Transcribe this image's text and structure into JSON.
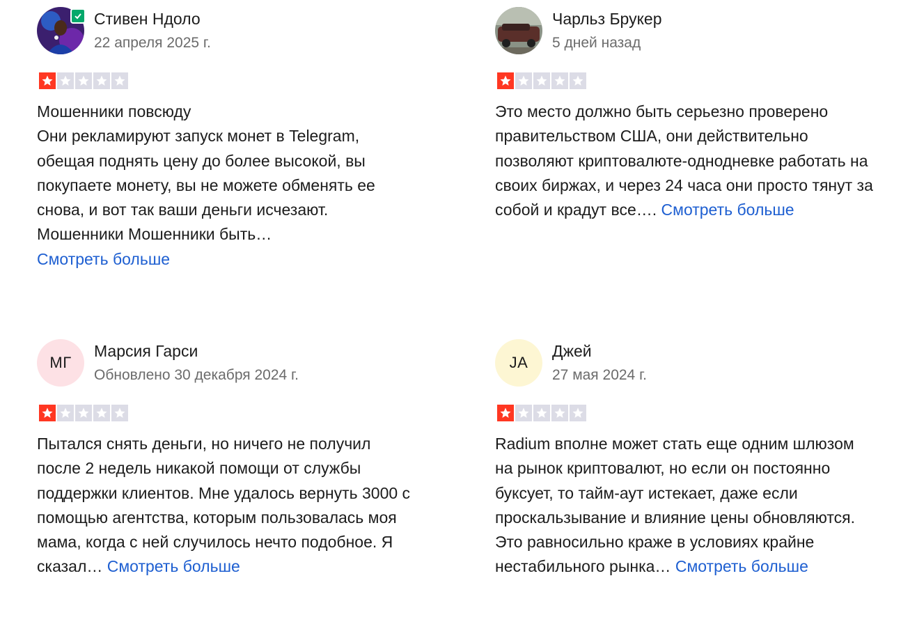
{
  "reviews": [
    {
      "name": "Стивен Ндоло",
      "date": "22 апреля 2025 г.",
      "rating": 1,
      "lines": [
        "Мошенники повсюду",
        "Они рекламируют запуск монет в Telegram, обещая поднять цену до более высокой, вы покупаете монету, вы не можете обменять ее снова, и вот так ваши деньги исчезают.",
        "Мошенники Мошенники быть…"
      ],
      "more": "Смотреть больше"
    },
    {
      "name": "Чарльз Брукер",
      "date": "5 дней назад",
      "rating": 1,
      "lines": [
        "Это место должно быть серьезно проверено правительством США, они действительно позволяют криптовалюте-однодневке работать на своих биржах, и через 24 часа они просто тянут за собой и крадут все…."
      ],
      "more": "Смотреть больше"
    },
    {
      "name": "Марсия Гарси",
      "initials": "МГ",
      "date": "Обновлено 30 декабря 2024 г.",
      "rating": 1,
      "lines": [
        "Пытался снять деньги, но ничего не получил после 2 недель никакой помощи от службы поддержки клиентов. Мне удалось вернуть 3000 с помощью агентства, которым пользовалась моя мама, когда с ней случилось нечто подобное. Я сказал…"
      ],
      "more": "Смотреть больше"
    },
    {
      "name": "Джей",
      "initials": "JA",
      "date": "27 мая 2024 г.",
      "rating": 1,
      "lines": [
        "Radium вполне может стать еще одним шлюзом на рынок криптовалют, но если он постоянно буксует, то тайм-аут истекает, даже если проскальзывание и влияние цены обновляются. Это равносильно краже в условиях крайне нестабильного рынка…"
      ],
      "more": "Смотреть больше"
    }
  ],
  "colors": {
    "star_on": "#ff3722",
    "star_off": "#dcdce6",
    "link": "#1e5fd1",
    "verified": "#04a86b",
    "avatar_mg_bg": "#fde1e5",
    "avatar_ja_bg": "#fdf6d3"
  }
}
